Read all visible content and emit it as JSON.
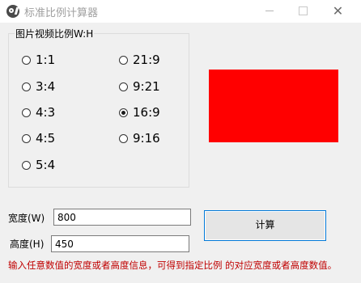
{
  "window": {
    "title": "标准比例计算器",
    "minimize": "—",
    "maximize": "",
    "close": "✕"
  },
  "ratio_group": {
    "legend": "图片视频比例W:H",
    "options": [
      {
        "label": "1:1",
        "checked": false
      },
      {
        "label": "21:9",
        "checked": false
      },
      {
        "label": "3:4",
        "checked": false
      },
      {
        "label": "9:21",
        "checked": false
      },
      {
        "label": "4:3",
        "checked": false
      },
      {
        "label": "16:9",
        "checked": true
      },
      {
        "label": "4:5",
        "checked": false
      },
      {
        "label": "9:16",
        "checked": false
      },
      {
        "label": "5:4",
        "checked": false
      }
    ]
  },
  "preview": {
    "color": "#ff0000"
  },
  "width_field": {
    "label": "宽度(W)",
    "value": "800"
  },
  "height_field": {
    "label": "高度(H)",
    "value": "450"
  },
  "calculate_button": {
    "label": "计算"
  },
  "hint": "输入任意数值的宽度或者高度信息，可得到指定比例 的对应宽度或者高度数值。"
}
